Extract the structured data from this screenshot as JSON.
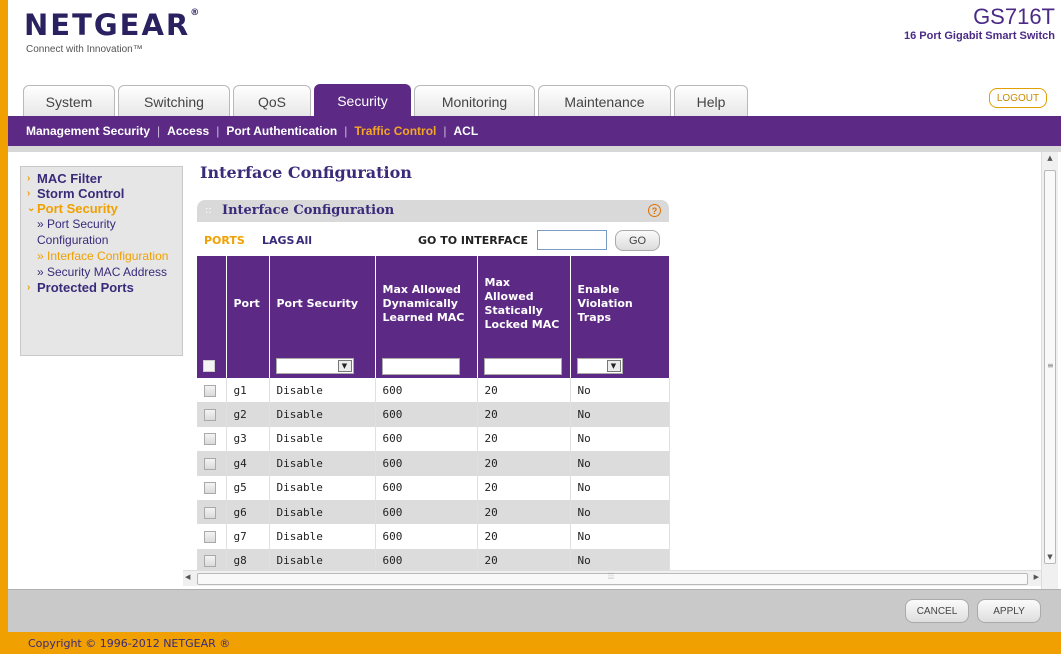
{
  "header": {
    "logo": "NETGEAR",
    "tagline": "Connect with Innovation™",
    "model": "GS716T",
    "model_sub": "16 Port Gigabit Smart Switch"
  },
  "tabs": [
    {
      "label": "System",
      "width": 92
    },
    {
      "label": "Switching",
      "width": 112
    },
    {
      "label": "QoS",
      "width": 78
    },
    {
      "label": "Security",
      "width": 97,
      "active": true
    },
    {
      "label": "Monitoring",
      "width": 121
    },
    {
      "label": "Maintenance",
      "width": 133
    },
    {
      "label": "Help",
      "width": 74
    }
  ],
  "logout_label": "LOGOUT",
  "subnav": [
    {
      "label": "Management Security"
    },
    {
      "label": "Access"
    },
    {
      "label": "Port Authentication"
    },
    {
      "label": "Traffic Control",
      "active": true
    },
    {
      "label": "ACL"
    }
  ],
  "leftnav": {
    "mac_filter": "MAC Filter",
    "storm_control": "Storm Control",
    "port_security": "Port Security",
    "port_security_config": "» Port Security Configuration",
    "interface_config": "» Interface Configuration",
    "security_mac": "» Security MAC Address",
    "protected_ports": "Protected Ports"
  },
  "page_title": "Interface Configuration",
  "panel": {
    "title": "Interface Configuration",
    "ports_link": "PORTS",
    "lags_link": "LAGS",
    "all_link": "All",
    "goto_label": "GO TO INTERFACE",
    "goto_value": "",
    "go_label": "GO"
  },
  "table": {
    "headers": [
      "Port",
      "Port Security",
      "Max Allowed Dynamically Learned MAC",
      "Max Allowed Statically Locked MAC",
      "Enable Violation Traps"
    ],
    "rows": [
      {
        "port": "g1",
        "security": "Disable",
        "dyn": "600",
        "stat": "20",
        "traps": "No"
      },
      {
        "port": "g2",
        "security": "Disable",
        "dyn": "600",
        "stat": "20",
        "traps": "No"
      },
      {
        "port": "g3",
        "security": "Disable",
        "dyn": "600",
        "stat": "20",
        "traps": "No"
      },
      {
        "port": "g4",
        "security": "Disable",
        "dyn": "600",
        "stat": "20",
        "traps": "No"
      },
      {
        "port": "g5",
        "security": "Disable",
        "dyn": "600",
        "stat": "20",
        "traps": "No"
      },
      {
        "port": "g6",
        "security": "Disable",
        "dyn": "600",
        "stat": "20",
        "traps": "No"
      },
      {
        "port": "g7",
        "security": "Disable",
        "dyn": "600",
        "stat": "20",
        "traps": "No"
      },
      {
        "port": "g8",
        "security": "Disable",
        "dyn": "600",
        "stat": "20",
        "traps": "No"
      }
    ]
  },
  "buttons": {
    "cancel": "CANCEL",
    "apply": "APPLY"
  },
  "footer": "Copyright © 1996-2012 NETGEAR ®"
}
